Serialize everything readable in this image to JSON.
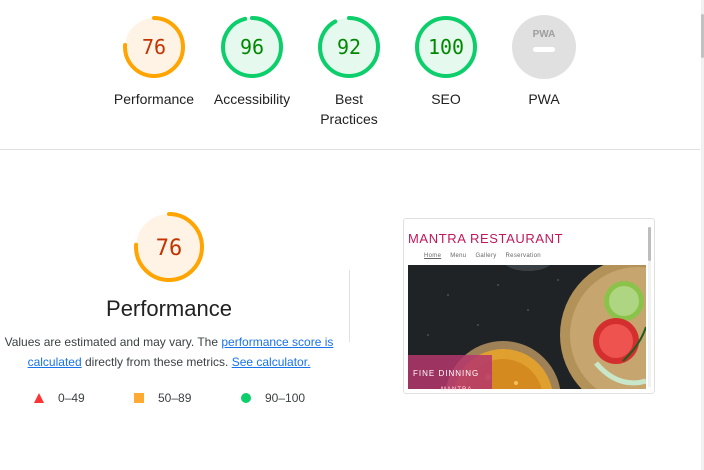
{
  "gauges": [
    {
      "label": "Performance",
      "score": "76",
      "value": 0.76,
      "status": "average"
    },
    {
      "label": "Accessibility",
      "score": "96",
      "value": 0.96,
      "status": "pass"
    },
    {
      "label": "Best Practices",
      "score": "92",
      "value": 0.92,
      "status": "pass"
    },
    {
      "label": "SEO",
      "score": "100",
      "value": 1.0,
      "status": "pass"
    },
    {
      "label": "PWA",
      "badge": "PWA",
      "status": "na"
    }
  ],
  "performance": {
    "score": "76",
    "value": 0.76,
    "title": "Performance",
    "desc_prefix": "Values are estimated and may vary. The ",
    "link_score": "performance score is calculated",
    "desc_mid": " directly from these metrics. ",
    "link_calc": "See calculator."
  },
  "legend": [
    {
      "shape": "triangle",
      "label": "0–49",
      "color": "#ff3333"
    },
    {
      "shape": "square",
      "label": "50–89",
      "color": "#ffaa33"
    },
    {
      "shape": "circle",
      "label": "90–100",
      "color": "#0cce6b"
    }
  ],
  "screenshot": {
    "brand": "MANTRA RESTAURANT",
    "nav": [
      "Home",
      "Menu",
      "Gallery",
      "Reservation"
    ],
    "hero_line1": "FINE DINNING",
    "hero_line2": "MANTRA"
  },
  "colors": {
    "pass_arc": "#0cce6b",
    "pass_text": "#008800",
    "pass_fill": "#e6f9ef",
    "avg_arc": "#ffa400",
    "avg_text": "#c33300",
    "avg_fill": "#fff3e6",
    "na_fill": "#e0e0e0",
    "na_text": "#9e9e9e",
    "link": "#1a73e8"
  }
}
